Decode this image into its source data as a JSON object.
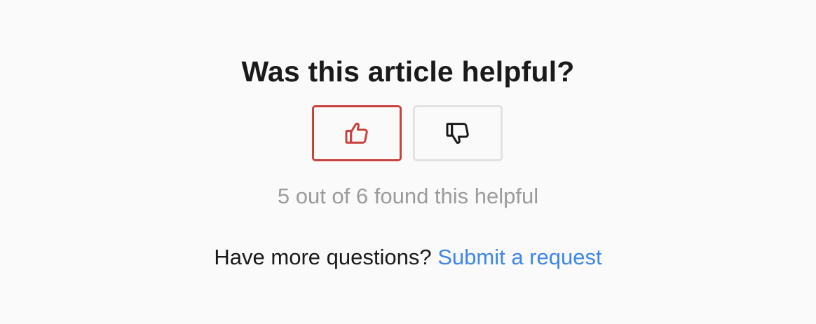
{
  "feedback": {
    "question": "Was this article helpful?",
    "upvote_icon": "thumbs-up-icon",
    "downvote_icon": "thumbs-down-icon",
    "upvote_selected": true,
    "count_text": "5 out of 6 found this helpful"
  },
  "footer": {
    "prompt": "Have more questions?",
    "link_label": "Submit a request"
  },
  "colors": {
    "background": "#fafafa",
    "selected_accent": "#c9423f",
    "link": "#3f86e8",
    "muted_text": "#9b9b9b"
  }
}
